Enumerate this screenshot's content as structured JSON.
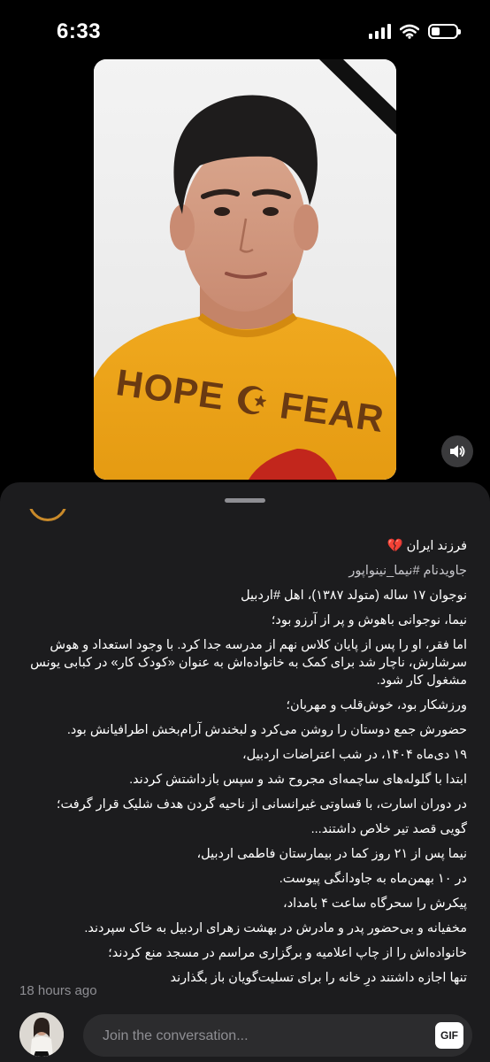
{
  "status_bar": {
    "time": "6:33",
    "battery_level": 0.35
  },
  "media": {
    "image_icon": "portrait-photo",
    "shirt_print": "HOPE ☪ FEAR",
    "volume_icon": "speaker-icon"
  },
  "post": {
    "lines": [
      "فرزند ایران 💔",
      "جاویدنام #نیما_نینواپور",
      "نوجوان ۱۷ ساله (متولد ۱۳۸۷)، اهل #اردبیل",
      "نیما، نوجوانی باهوش و پر از آرزو بود؛",
      "اما فقر، او را پس از پایان کلاس نهم از مدرسه جدا کرد. با وجود استعداد و هوش سرشارش، ناچار شد برای کمک به خانواده‌اش به عنوان «کودک کار» در کبابی یونس مشغول کار شود.",
      "ورزشکار بود، خوش‌قلب و مهربان؛",
      "حضورش جمع دوستان را روشن می‌کرد و لبخندش آرام‌بخش اطرافیانش بود.",
      "۱۹ دی‌ماه ۱۴۰۴، در شب اعتراضات اردبیل،",
      "ابتدا با گلوله‌های ساچمه‌ای مجروح شد و سپس بازداشتش کردند.",
      "در دوران اسارت، با قساوتی غیرانسانی از ناحیه گردن هدف شلیک قرار گرفت؛",
      "گویی قصد تیر خلاص داشتند...",
      "نیما پس از ۲۱ روز کما در بیمارستان فاطمی اردبیل،",
      "در ۱۰ بهمن‌ماه به جاودانگی پیوست.",
      "پیکرش را سحرگاه ساعت ۴ بامداد،",
      "مخفیانه و بی‌حضور پدر و مادرش در بهشت زهرای اردبیل به خاک سپردند.",
      "خانواده‌اش را از چاپ اعلامیه و برگزاری مراسم در مسجد منع کردند؛",
      "تنها اجازه داشتند درِ خانه را برای تسلیت‌گویان باز بگذارند"
    ],
    "timestamp": "18 hours ago"
  },
  "composer": {
    "placeholder": "Join the conversation...",
    "gif_label": "GIF"
  }
}
